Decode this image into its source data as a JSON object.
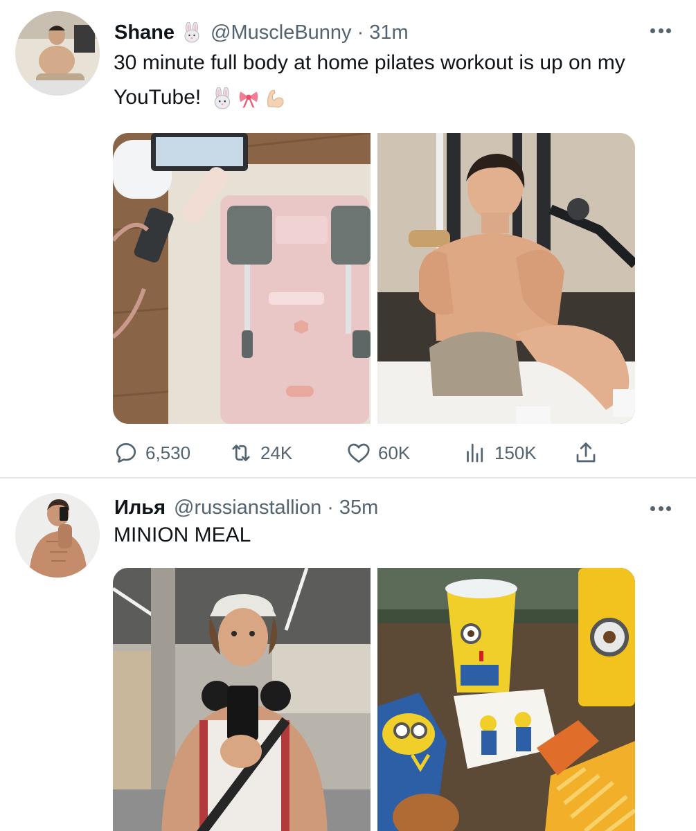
{
  "tweets": [
    {
      "name": "Shane",
      "handle": "@MuscleBunny",
      "separator": "·",
      "time": "31m",
      "text": "30 minute full body at home pilates workout is up on my YouTube!",
      "emojis": [
        "rabbit-face-emoji",
        "ribbon-emoji",
        "flexed-biceps-emoji"
      ],
      "name_badge": "rabbit-face-emoji",
      "actions": {
        "replies": "6,530",
        "retweets": "24K",
        "likes": "60K",
        "views": "150K"
      },
      "media": [
        "pilates-equipment-photo",
        "shirtless-man-gym-photo"
      ]
    },
    {
      "name": "Илья",
      "handle": "@russianstallion",
      "separator": "·",
      "time": "35m",
      "text": "MINION MEAL",
      "media": [
        "gym-mirror-selfie-photo",
        "mcdonalds-minion-meal-photo"
      ]
    }
  ],
  "colors": {
    "text": "#0f1419",
    "secondary": "#536471",
    "divider": "#e6e9ec"
  }
}
